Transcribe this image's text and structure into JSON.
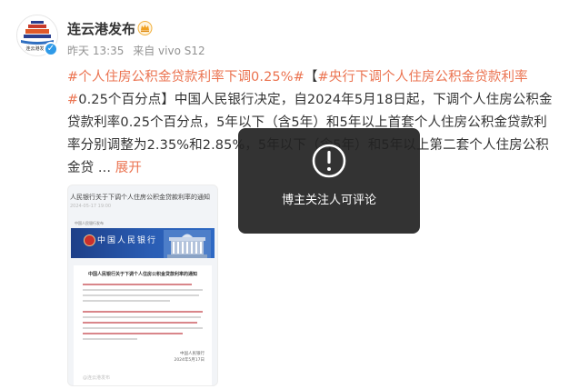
{
  "post": {
    "author": "连云港发布",
    "avatar_caption": "连云港发布",
    "time": "昨天 13:35",
    "source": "来自 vivo S12",
    "text": {
      "hashtag1": "#个人住房公积金贷款利率下调0.25%#",
      "bracket_open": "【",
      "hashtag2": "#央行下调个人住房公积金贷款利率#",
      "body": "0.25个百分点】中国人民银行决定，自2024年5月18日起，下调个人住房公积金贷款利率0.25个百分点，5年以下（含5年）和5年以上首套个人住房公积金贷款利率分别调整为2.35%和2.85%，5年以下（含5年）和5年以上第二套个人住房公积金贷",
      "ellipsis": " ...",
      "expand_label": "展开"
    },
    "image": {
      "doc_title": "人民银行关于下调个人住房公积金贷款利率的通知",
      "doc_sub": "2024-05-17 19:00",
      "banner_top": "中国人民银行发布",
      "bank_name": "中国人民银行",
      "paper_heading": "中国人民银行关于下调个人住房公积金贷款利率的通知",
      "paper_sign": "中国人民银行",
      "paper_date": "2024年5月17日",
      "watermark": "@连云港发布"
    }
  },
  "overlay": {
    "message": "博主关注人可评论",
    "icon": "exclamation-circle-icon"
  },
  "colors": {
    "hashtag": "#eb7350",
    "verified": "#2f9ae8",
    "overlay_bg": "#222222"
  }
}
